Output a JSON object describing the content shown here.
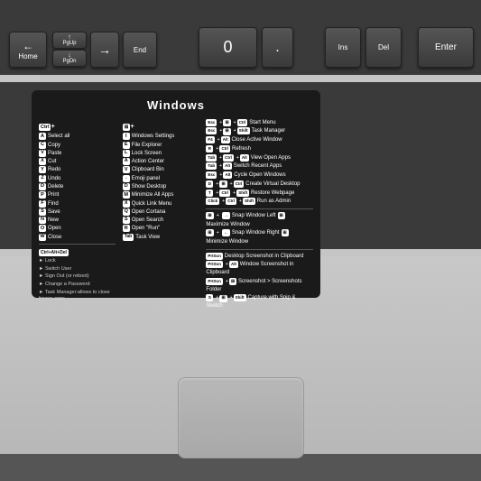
{
  "sticker": {
    "title": "Windows",
    "ctrl_section": {
      "header": "Ctrl+",
      "shortcuts": [
        {
          "key": "A",
          "label": "Select all"
        },
        {
          "key": "C",
          "label": "Copy"
        },
        {
          "key": "V",
          "label": "Paste"
        },
        {
          "key": "X",
          "label": "Cut"
        },
        {
          "key": "Y",
          "label": "Redo"
        },
        {
          "key": "Z",
          "label": "Undo"
        },
        {
          "key": "D",
          "label": "Delete"
        },
        {
          "key": "P",
          "label": "Print"
        },
        {
          "key": "F",
          "label": "Find"
        },
        {
          "key": "S",
          "label": "Save"
        },
        {
          "key": "N",
          "label": "New"
        },
        {
          "key": "O",
          "label": "Open"
        },
        {
          "key": "W",
          "label": "Close"
        }
      ]
    },
    "win_section": {
      "header": "⊞+",
      "shortcuts": [
        {
          "keys": "I",
          "label": "Windows Settings"
        },
        {
          "keys": "L",
          "label": "Lock Screen"
        },
        {
          "keys": "A",
          "label": "Action Center"
        },
        {
          "keys": "V",
          "label": "Clipboard Bin"
        },
        {
          "keys": ".",
          "label": "Emoji panel"
        },
        {
          "keys": "D",
          "label": "Show Desktop"
        },
        {
          "keys": "M",
          "label": "Minimize All Apps"
        },
        {
          "keys": "X",
          "label": "Quick Link Menu"
        },
        {
          "keys": "Q",
          "label": "Open Cortana"
        },
        {
          "keys": "S",
          "label": "Open Search"
        },
        {
          "keys": "R",
          "label": "Open \"Run\""
        },
        {
          "keys": "Tab",
          "label": "Task View"
        }
      ]
    },
    "right_section": {
      "shortcuts": [
        {
          "combo": "Esc + ⊞ + Ctrl",
          "label": "Start Menu"
        },
        {
          "combo": "Esc + ⊞ + Shift",
          "label": "Task Manager"
        },
        {
          "combo": "F4 + Alt",
          "label": "Close Active Window"
        },
        {
          "combo": "R + Ctrl",
          "label": "Refresh"
        },
        {
          "combo": "Tab + Ctrl + Alt",
          "label": "View Open Apps"
        },
        {
          "combo": "Tab + Alt",
          "label": "Switch Recent Apps"
        },
        {
          "combo": "Esc + Alt",
          "label": "Cycle Open Windows"
        },
        {
          "combo": "D + ⊞ + Ctrl",
          "label": "Create Virtual Desktop"
        },
        {
          "combo": "T + Ctrl + Shift",
          "label": "Restore Webpage"
        },
        {
          "combo": "Click + Ctrl + Shift",
          "label": "Run as Admin"
        }
      ]
    },
    "snap_section": {
      "left": {
        "combo": "⊞ + →",
        "label": "Snap Window Left",
        "icon": "⊞",
        "label2": "Maximize Window"
      },
      "right": {
        "combo": "⊞ + ←",
        "label": "Snap Window Right",
        "icon": "⊞",
        "label2": "Minimize Window"
      }
    },
    "ctrl_alt_del": {
      "header": "Ctrl+Alt+Del",
      "items": [
        {
          "bullet": "►",
          "label": "Lock"
        },
        {
          "bullet": "►",
          "label": "Sign Out (or reboot)"
        },
        {
          "bullet": "►",
          "label": "Switch User"
        },
        {
          "bullet": "►",
          "label": "Change a Password"
        },
        {
          "bullet": "►",
          "label": "Task Manager:allows to close frozen apps"
        }
      ]
    },
    "screenshot_section": {
      "items": [
        {
          "combo": "PrtScn",
          "label": "Desktop Screenshot in Clipboard"
        },
        {
          "combo": "PrtScn + Alt",
          "label": "Window Screenshot in Clipboard"
        },
        {
          "combo": "PrtScn + ⊞",
          "label": "Screenshot > Screenshots Folder"
        },
        {
          "combo": "S + ⊞ + Shift",
          "label": "Capture with Snip & Sketch"
        }
      ]
    }
  },
  "keys": {
    "home": "Home",
    "end": "End",
    "pgup": "PgUp",
    "pgdn": "PgDn",
    "ins": "Ins",
    "del": "Del",
    "enter": "Enter",
    "zero": "0",
    "dot": "."
  }
}
